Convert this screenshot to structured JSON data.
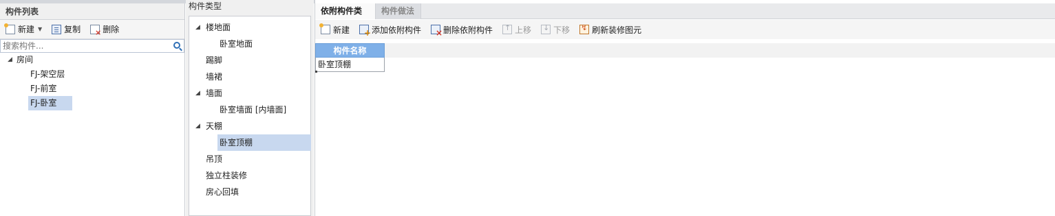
{
  "left_panel": {
    "title": "构件列表",
    "toolbar": {
      "new": "新建",
      "copy": "复制",
      "delete": "删除"
    },
    "search": {
      "placeholder": "搜索构件..."
    },
    "tree": {
      "root": "房间",
      "children": [
        "FJ-架空层",
        "FJ-前室",
        "FJ-卧室"
      ],
      "selected": "FJ-卧室"
    }
  },
  "middle_panel": {
    "title": "构件类型",
    "items": [
      {
        "label": "楼地面",
        "expanded": true
      },
      {
        "label": "卧室地面"
      },
      {
        "label": "踢脚"
      },
      {
        "label": "墙裙"
      },
      {
        "label": "墙面",
        "expanded": true
      },
      {
        "label": "卧室墙面 [内墙面]"
      },
      {
        "label": "天棚",
        "expanded": true
      },
      {
        "label": "卧室顶棚",
        "selected": true
      },
      {
        "label": "吊顶"
      },
      {
        "label": "独立柱装修"
      },
      {
        "label": "房心回填"
      }
    ]
  },
  "right_panel": {
    "tabs": [
      {
        "label": "依附构件类型",
        "active": true
      },
      {
        "label": "构件做法",
        "active": false
      }
    ],
    "toolbar": {
      "new": "新建",
      "add": "添加依附构件",
      "remove": "删除依附构件",
      "up": "上移",
      "down": "下移",
      "refresh": "刷新装修图元"
    },
    "grid": {
      "header": "构件名称",
      "rows": [
        "卧室顶棚"
      ]
    }
  },
  "colors": {
    "selection": "#c8d8ef",
    "grid_header": "#7fb0e8",
    "panel_bg": "#f0f0f0"
  }
}
